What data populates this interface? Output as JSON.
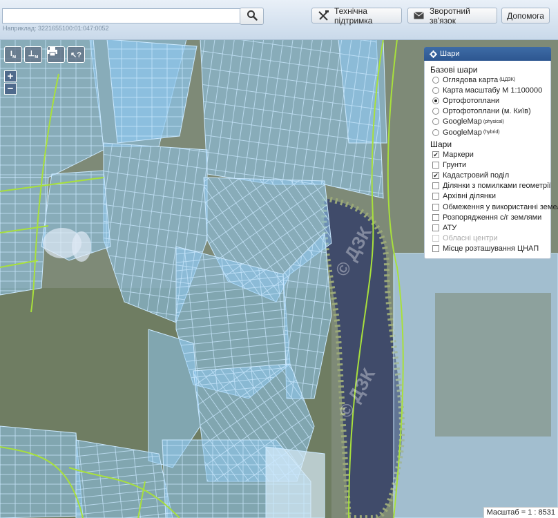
{
  "search": {
    "value": "",
    "hint": "Наприклад: 3221655100:01:047:0052"
  },
  "toolbar": {
    "support_label": "Технічна підтримка",
    "feedback_label": "Зворотний зв'язок",
    "help_label": "Допомога"
  },
  "tools": {
    "measure_line": "м",
    "measure_area": "м"
  },
  "zoom": {
    "in": "+",
    "out": "−"
  },
  "layers": {
    "title": "Шари",
    "base_title": "Базові шари",
    "base": [
      {
        "label": "Оглядова карта",
        "sup": "(ЦДЗК)",
        "selected": false
      },
      {
        "label": "Карта масштабу М 1:100000",
        "sup": "",
        "selected": false
      },
      {
        "label": "Ортофотоплани",
        "sup": "",
        "selected": true
      },
      {
        "label": "Ортофотоплани (м. Київ)",
        "sup": "",
        "selected": false
      },
      {
        "label": "GoogleMap",
        "sup": "(physical)",
        "selected": false
      },
      {
        "label": "GoogleMap",
        "sup": "(hybrid)",
        "selected": false
      }
    ],
    "overlay_title": "Шари",
    "overlays": [
      {
        "label": "Маркери",
        "checked": true,
        "disabled": false
      },
      {
        "label": "Грунти",
        "checked": false,
        "disabled": false
      },
      {
        "label": "Кадастровий поділ",
        "checked": true,
        "disabled": false
      },
      {
        "label": "Ділянки з помилками геометрії",
        "checked": false,
        "disabled": false
      },
      {
        "label": "Архівні ділянки",
        "checked": false,
        "disabled": false
      },
      {
        "label": "Обмеження у використанні земель",
        "checked": false,
        "disabled": false
      },
      {
        "label": "Розпорядження с/г землями",
        "checked": false,
        "disabled": false
      },
      {
        "label": "АТУ",
        "checked": false,
        "disabled": false
      },
      {
        "label": "Обласні центри",
        "checked": false,
        "disabled": true
      },
      {
        "label": "Місце розташування ЦНАП",
        "checked": false,
        "disabled": false
      }
    ]
  },
  "scale": "Масштаб = 1 : 8531",
  "watermark": "© ДЗК",
  "colors": {
    "parcel_fill": "#8fc8f0",
    "parcel_stroke": "#c6e8ff",
    "boundary": "#a8e03c",
    "water": "#3f4a6a",
    "header_blue": "#2d5690"
  }
}
